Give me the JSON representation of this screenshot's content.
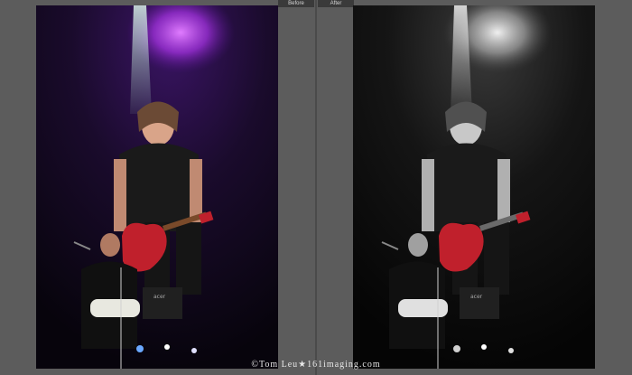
{
  "labels": {
    "before": "Before",
    "after": "After"
  },
  "watermark": "©Tom Leu★161imaging.com",
  "colors": {
    "background": "#5c5c5c",
    "tab": "#3a3a3a",
    "guitar_red": "#c0202c",
    "spotlight_purple": "#9b2fd6"
  }
}
